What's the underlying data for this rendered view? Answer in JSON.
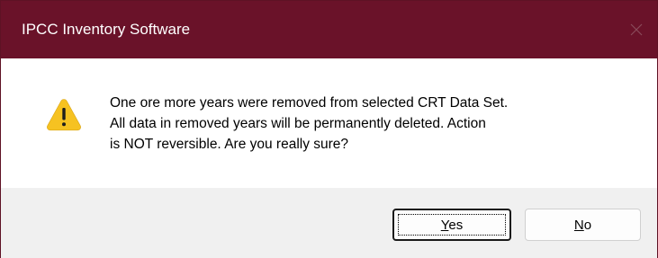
{
  "window": {
    "title": "IPCC Inventory Software"
  },
  "message": {
    "lines": [
      "One ore more years were removed from selected CRT Data Set.",
      "All data in removed years will be permanently deleted. Action",
      "is NOT reversible. Are you really sure?"
    ]
  },
  "buttons": {
    "yes": {
      "mnemonic": "Y",
      "rest": "es"
    },
    "no": {
      "mnemonic": "N",
      "rest": "o"
    }
  },
  "icons": {
    "warning": "warning-triangle-icon",
    "close": "close-icon"
  },
  "colors": {
    "titlebar": "#6a1229",
    "warning_yellow": "#f6c221",
    "footer": "#f0f0f0"
  }
}
